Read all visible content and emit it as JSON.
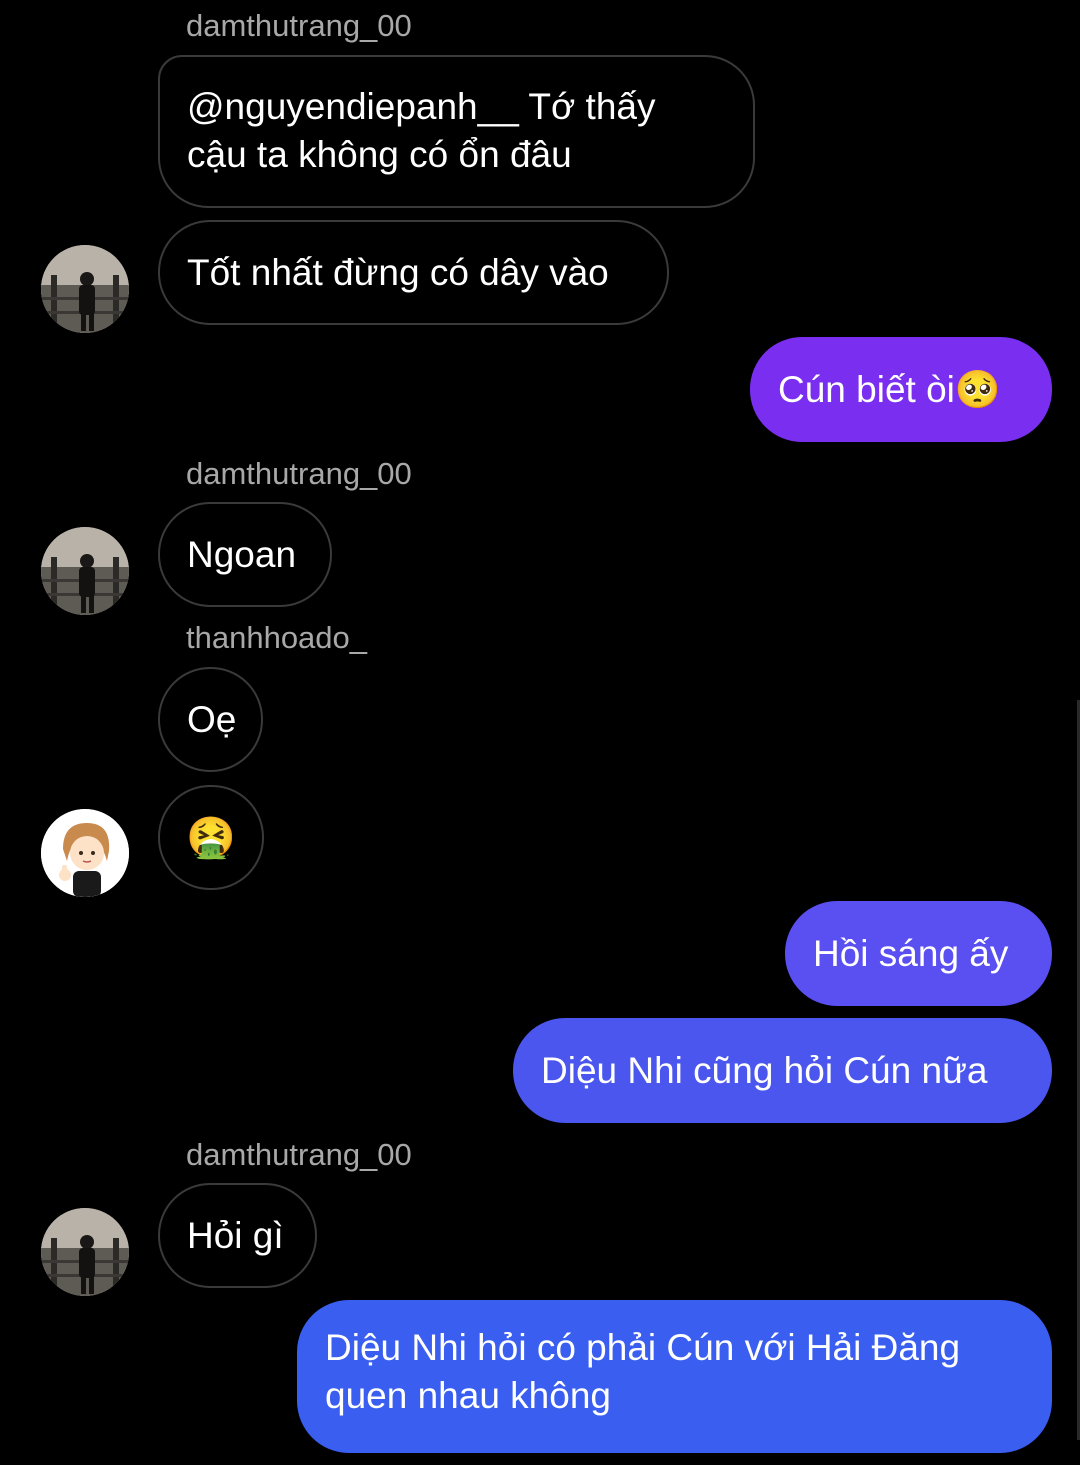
{
  "messages": [
    {
      "sender": "damthutrang_00",
      "text_line1": "@nguyendiepanh__ Tớ thấy",
      "text_line2": "cậu ta không có ổn đâu"
    },
    {
      "text": "Tốt nhất đừng có dây vào"
    },
    {
      "text": "Cún biết òi",
      "emoji": "🥺"
    },
    {
      "sender": "damthutrang_00",
      "text": "Ngoan"
    },
    {
      "sender": "thanhhoado_",
      "text": "Oẹ"
    },
    {
      "emoji": "🤮"
    },
    {
      "text": "Hồi sáng ấy"
    },
    {
      "text": "Diệu Nhi cũng hỏi Cún nữa"
    },
    {
      "sender": "damthutrang_00",
      "text": "Hỏi gì"
    },
    {
      "text_line1": "Diệu Nhi hỏi có phải Cún với Hải Đăng",
      "text_line2": "quen nhau không"
    }
  ],
  "colors": {
    "background": "#000000",
    "received_border": "#3a3a3a",
    "sender_label": "#a8a8a8",
    "sent_purple": "#7a2ef0",
    "sent_indigo_1": "#5a4ff0",
    "sent_indigo_2": "#4a56ee",
    "sent_blue": "#3a5ef0"
  }
}
